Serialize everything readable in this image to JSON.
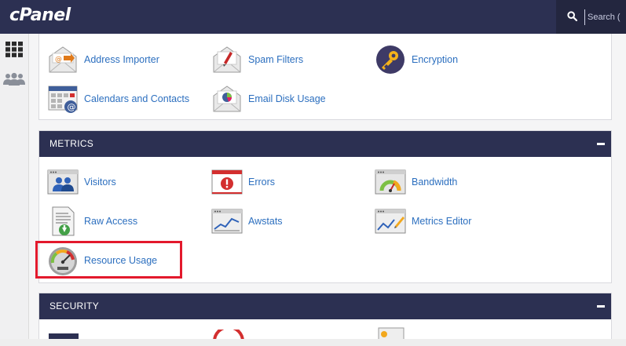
{
  "header": {
    "logo": "cPanel",
    "search_placeholder": "Search ("
  },
  "top_items": [
    {
      "label": "Address Importer",
      "icon": "address-importer-icon"
    },
    {
      "label": "Spam Filters",
      "icon": "spam-filters-icon"
    },
    {
      "label": "Encryption",
      "icon": "encryption-icon"
    },
    {
      "label": "Calendars and Contacts",
      "icon": "calendars-icon"
    },
    {
      "label": "Email Disk Usage",
      "icon": "email-disk-usage-icon"
    }
  ],
  "metrics": {
    "title": "METRICS",
    "items": [
      {
        "label": "Visitors",
        "icon": "visitors-icon"
      },
      {
        "label": "Errors",
        "icon": "errors-icon"
      },
      {
        "label": "Bandwidth",
        "icon": "bandwidth-icon"
      },
      {
        "label": "Raw Access",
        "icon": "raw-access-icon"
      },
      {
        "label": "Awstats",
        "icon": "awstats-icon"
      },
      {
        "label": "Metrics Editor",
        "icon": "metrics-editor-icon"
      },
      {
        "label": "Resource Usage",
        "icon": "resource-usage-icon"
      }
    ]
  },
  "security": {
    "title": "SECURITY"
  },
  "colors": {
    "header_bg": "#2c3052",
    "link": "#2c6fbf",
    "highlight": "#e3192c"
  }
}
